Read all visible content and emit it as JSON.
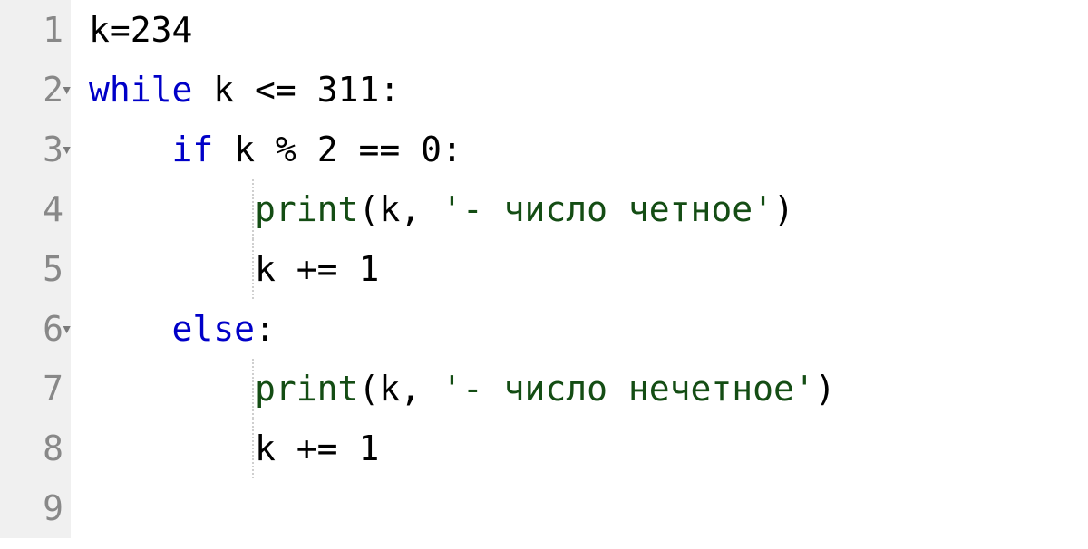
{
  "editor": {
    "lines": [
      {
        "number": "1",
        "foldable": false,
        "indent": 0,
        "guides": [],
        "tokens": [
          {
            "cls": "tk-default",
            "text": "k"
          },
          {
            "cls": "tk-operator",
            "text": "="
          },
          {
            "cls": "tk-number",
            "text": "234"
          }
        ]
      },
      {
        "number": "2",
        "foldable": true,
        "indent": 0,
        "guides": [],
        "tokens": [
          {
            "cls": "tk-keyword",
            "text": "while"
          },
          {
            "cls": "tk-default",
            "text": " k "
          },
          {
            "cls": "tk-operator",
            "text": "<="
          },
          {
            "cls": "tk-default",
            "text": " "
          },
          {
            "cls": "tk-number",
            "text": "311"
          },
          {
            "cls": "tk-punct",
            "text": ":"
          }
        ]
      },
      {
        "number": "3",
        "foldable": true,
        "indent": 1,
        "guides": [],
        "tokens": [
          {
            "cls": "tk-keyword",
            "text": "if"
          },
          {
            "cls": "tk-default",
            "text": " k "
          },
          {
            "cls": "tk-operator",
            "text": "%"
          },
          {
            "cls": "tk-default",
            "text": " "
          },
          {
            "cls": "tk-number",
            "text": "2"
          },
          {
            "cls": "tk-default",
            "text": " "
          },
          {
            "cls": "tk-operator",
            "text": "=="
          },
          {
            "cls": "tk-default",
            "text": " "
          },
          {
            "cls": "tk-number",
            "text": "0"
          },
          {
            "cls": "tk-punct",
            "text": ":"
          }
        ]
      },
      {
        "number": "4",
        "foldable": false,
        "indent": 2,
        "guides": [
          1
        ],
        "tokens": [
          {
            "cls": "tk-builtin",
            "text": "print"
          },
          {
            "cls": "tk-punct",
            "text": "("
          },
          {
            "cls": "tk-default",
            "text": "k"
          },
          {
            "cls": "tk-punct",
            "text": ","
          },
          {
            "cls": "tk-default",
            "text": " "
          },
          {
            "cls": "tk-string",
            "text": "'- число четное'"
          },
          {
            "cls": "tk-punct",
            "text": ")"
          }
        ]
      },
      {
        "number": "5",
        "foldable": false,
        "indent": 2,
        "guides": [
          1
        ],
        "tokens": [
          {
            "cls": "tk-default",
            "text": "k "
          },
          {
            "cls": "tk-operator",
            "text": "+="
          },
          {
            "cls": "tk-default",
            "text": " "
          },
          {
            "cls": "tk-number",
            "text": "1"
          }
        ]
      },
      {
        "number": "6",
        "foldable": true,
        "indent": 1,
        "guides": [],
        "tokens": [
          {
            "cls": "tk-keyword",
            "text": "else"
          },
          {
            "cls": "tk-punct",
            "text": ":"
          }
        ]
      },
      {
        "number": "7",
        "foldable": false,
        "indent": 2,
        "guides": [
          1
        ],
        "tokens": [
          {
            "cls": "tk-builtin",
            "text": "print"
          },
          {
            "cls": "tk-punct",
            "text": "("
          },
          {
            "cls": "tk-default",
            "text": "k"
          },
          {
            "cls": "tk-punct",
            "text": ","
          },
          {
            "cls": "tk-default",
            "text": " "
          },
          {
            "cls": "tk-string",
            "text": "'- число нечетное'"
          },
          {
            "cls": "tk-punct",
            "text": ")"
          }
        ]
      },
      {
        "number": "8",
        "foldable": false,
        "indent": 2,
        "guides": [
          1
        ],
        "tokens": [
          {
            "cls": "tk-default",
            "text": "k "
          },
          {
            "cls": "tk-operator",
            "text": "+="
          },
          {
            "cls": "tk-default",
            "text": " "
          },
          {
            "cls": "tk-number",
            "text": "1"
          }
        ]
      },
      {
        "number": "9",
        "foldable": false,
        "indent": 0,
        "guides": [],
        "tokens": []
      }
    ],
    "fold_glyph": "▾",
    "indent_spaces": "    "
  }
}
